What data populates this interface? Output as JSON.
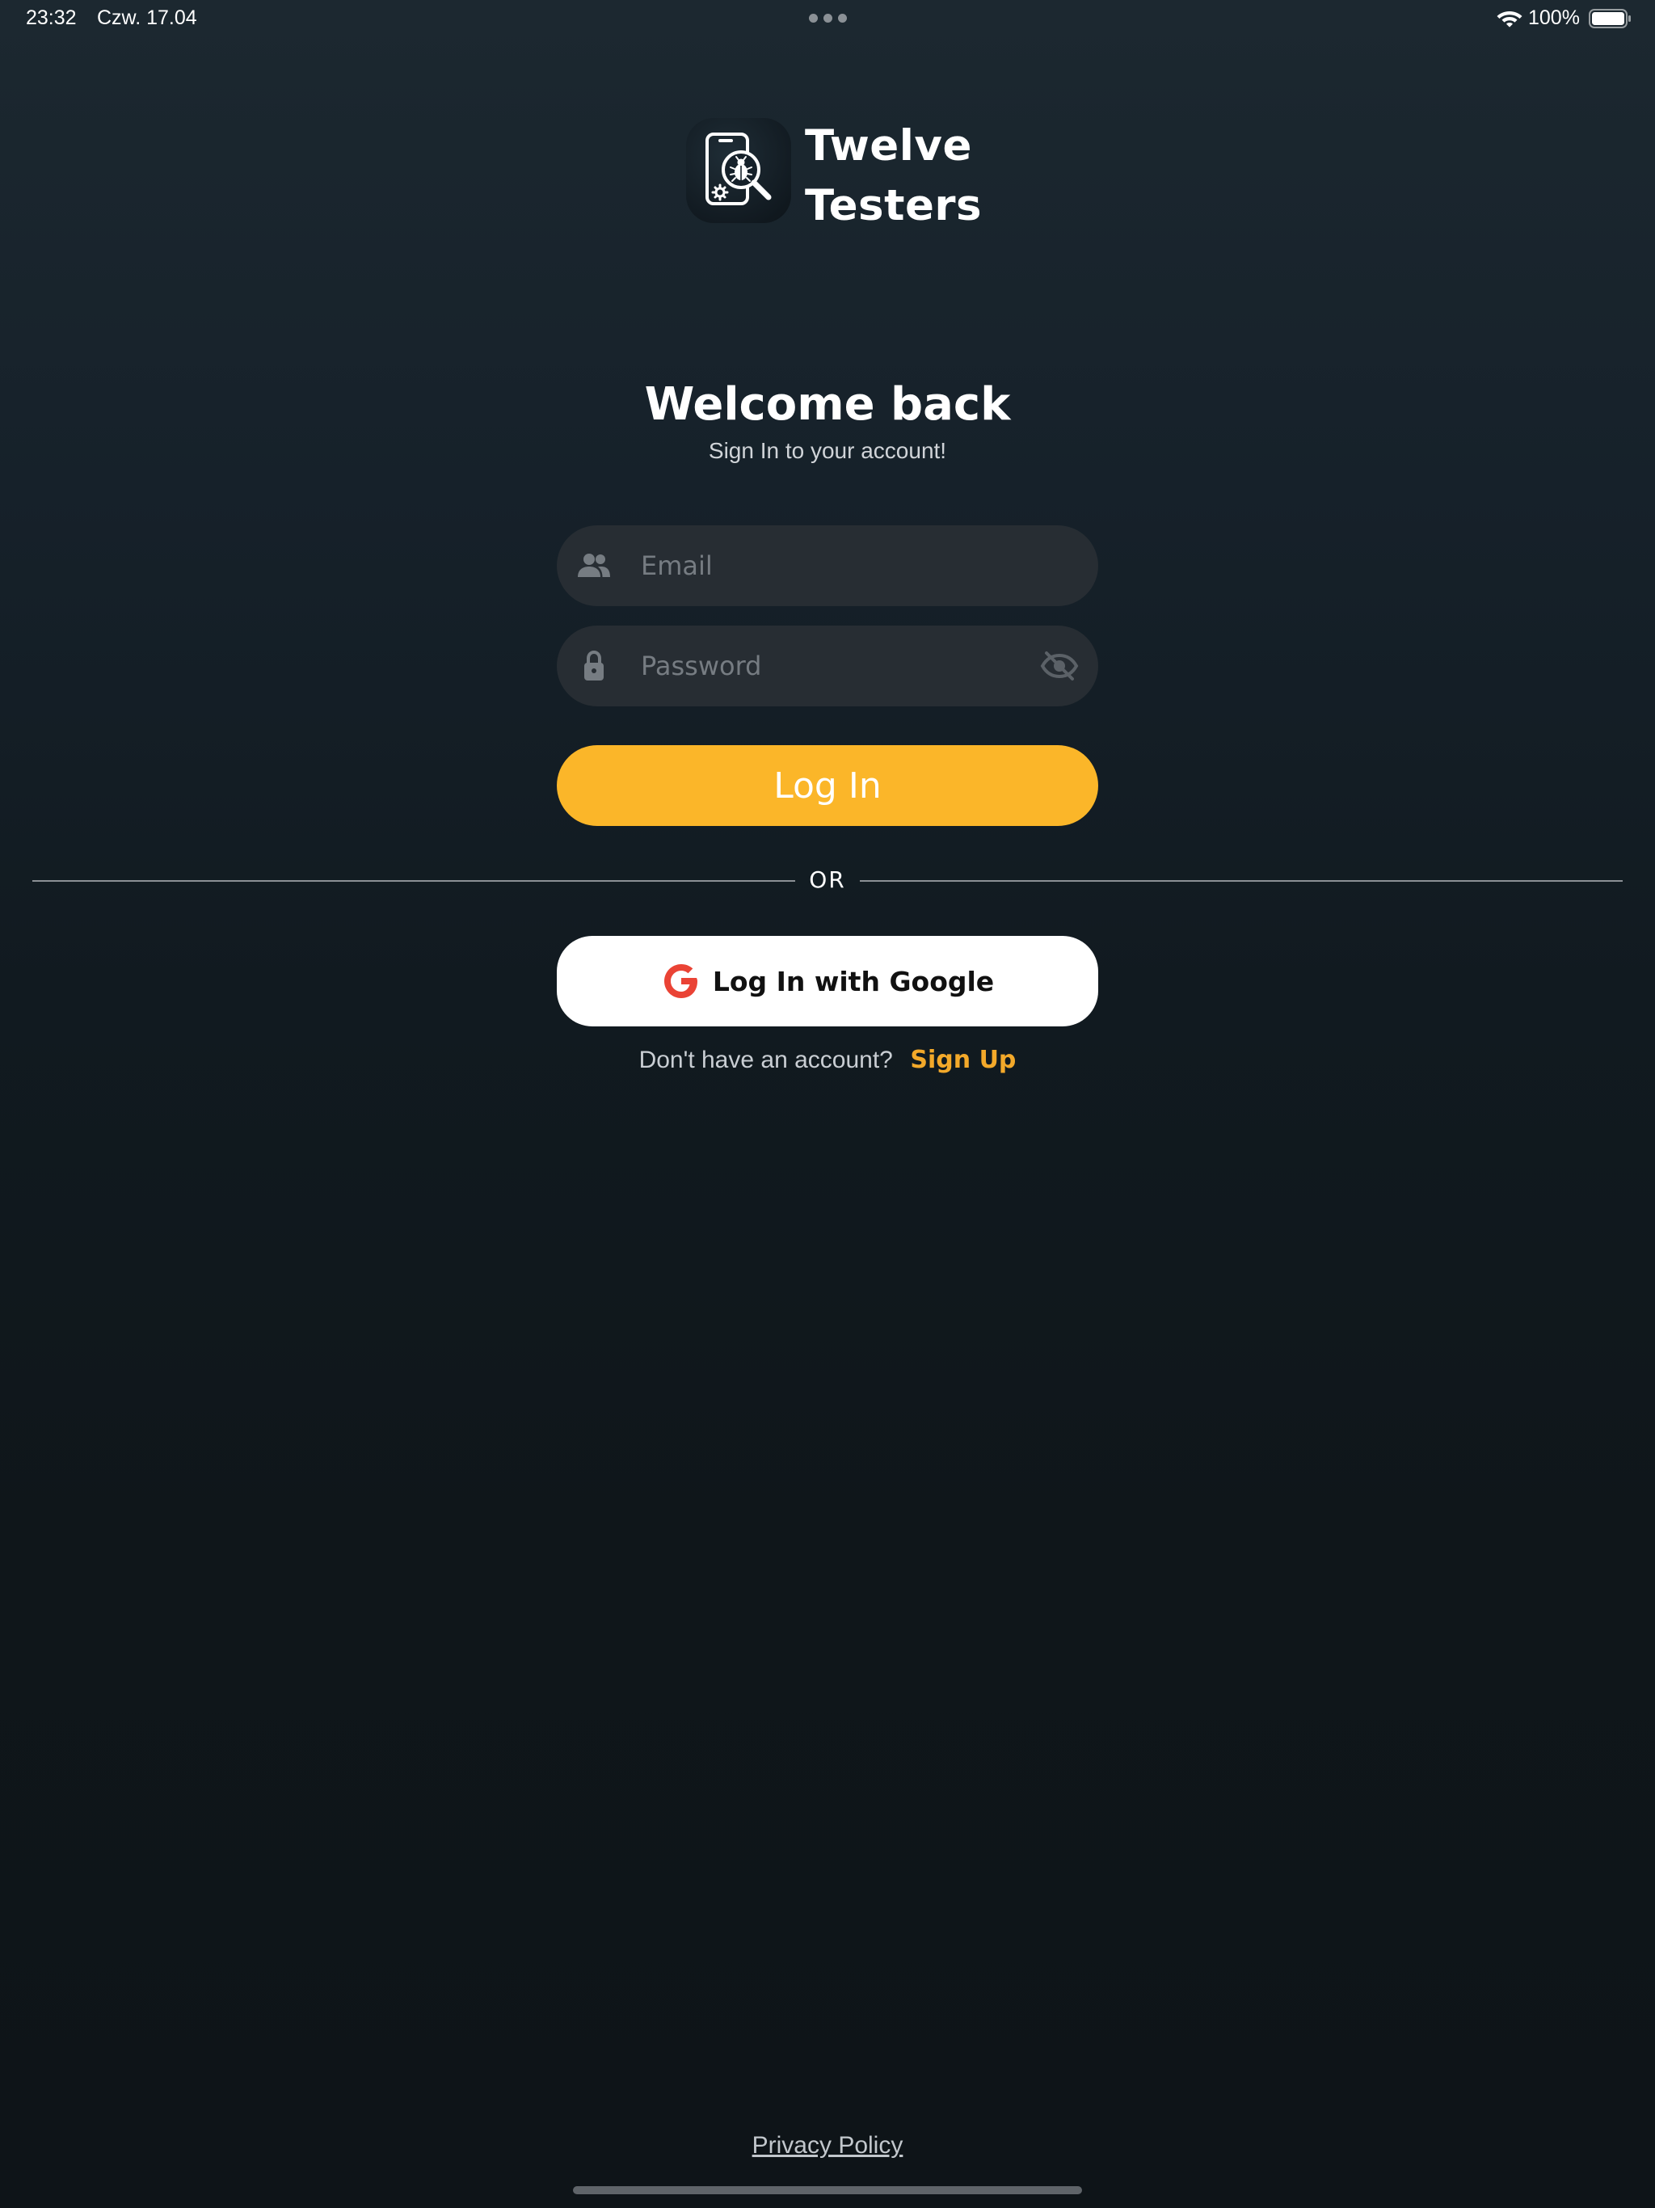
{
  "status_bar": {
    "time": "23:32",
    "date": "Czw. 17.04",
    "battery_percent": "100%",
    "icons": [
      "more-dots-icon",
      "wifi-icon",
      "battery-icon"
    ]
  },
  "brand": {
    "line1": "Twelve",
    "line2": "Testers",
    "icon": "phone-bug-search-icon"
  },
  "heading": {
    "title": "Welcome back",
    "subtitle": "Sign In to your account!"
  },
  "form": {
    "email_placeholder": "Email",
    "email_value": "",
    "email_icon": "users-icon",
    "password_placeholder": "Password",
    "password_value": "",
    "password_icon": "lock-icon",
    "password_toggle_icon": "eye-off-icon",
    "login_label": "Log In"
  },
  "divider": {
    "label": "OR"
  },
  "google": {
    "label": "Log In with Google",
    "icon": "google-g-icon"
  },
  "signup": {
    "prompt": "Don't have an account?",
    "link": "Sign Up"
  },
  "footer": {
    "privacy": "Privacy Policy"
  },
  "colors": {
    "accent": "#fbb629",
    "link": "#f3a92a",
    "field_bg": "#272d33",
    "google_red": "#ea4335"
  }
}
